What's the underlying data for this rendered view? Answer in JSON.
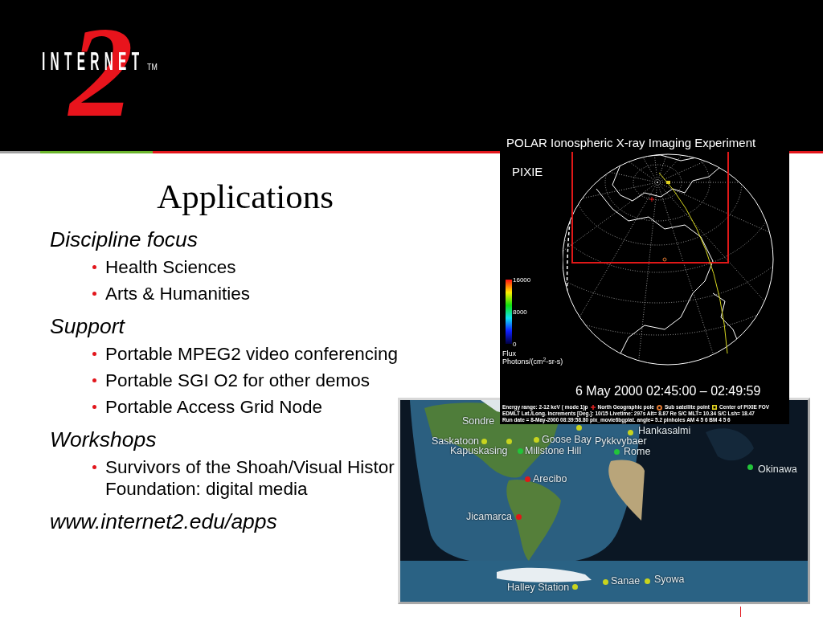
{
  "logo": {
    "numeral": "2",
    "wordmark": "INTERNET",
    "trademark": "TM"
  },
  "slide": {
    "title": "Applications",
    "sections": [
      {
        "heading": "Discipline focus",
        "bullets": [
          "Health Sciences",
          "Arts & Humanities"
        ]
      },
      {
        "heading": "Support",
        "bullets": [
          "Portable MPEG2 video conferencing",
          "Portable SGI O2 for other demos",
          "Portable Access Grid Node"
        ]
      },
      {
        "heading": "Workshops",
        "bullets": [
          "Survivors of the Shoah/Visual Histor Foundation: digital media"
        ]
      }
    ],
    "url": "www.internet2.edu/apps"
  },
  "pixie_image": {
    "title": "POLAR Ionospheric X-ray Imaging Experiment",
    "subtitle": "PIXIE",
    "scale_labels": [
      "16000",
      "8000",
      "0"
    ],
    "scale_title": "Flux",
    "scale_units": "Photons/(cm$^{2}$-sr-s)",
    "timestamp": "6 May 2000 02:45:00 – 02:49:59",
    "caption": {
      "energy_range": "Energy range: 2-12 keV ( mode 1)p",
      "legend": [
        {
          "kind": "plus",
          "label": "North Geographic pole",
          "color": "#e02020"
        },
        {
          "kind": "ring",
          "label": "Sub satellite point",
          "color": "#e07830"
        },
        {
          "kind": "square",
          "label": "Center of PIXIE FOV",
          "color": "#e0d020"
        }
      ],
      "lines": [
        "EDMLT Lat./Long. increments [Deg.]: 10/15 Livetime: 297s Alt= 8.87 Re S/C MLT= 10.34 S/C Lsh= 18.47",
        "Run date = 8-May-2000 08:39:58.80 pix_movie6bgplat. angle= 5.2 pinholes AM 4 5 6 BM 4 5 6"
      ]
    }
  },
  "map": {
    "pins": [
      {
        "label": "Sondre"
      },
      {
        "label": "Saskatoon",
        "color": "#c8d41e"
      },
      {
        "label": "Kapuskasing",
        "color": "#c8d41e"
      },
      {
        "label": "Goose Bay",
        "color": "#c8d41e"
      },
      {
        "label": "Millstone Hill",
        "color": "#22c43a"
      },
      {
        "label": "Arecibo",
        "color": "#e01818"
      },
      {
        "label": "Jicamarca",
        "color": "#e01818"
      },
      {
        "label": "Halley Station",
        "color": "#c8d41e"
      },
      {
        "label": "Pykkvybaer",
        "color": "#c8d41e"
      },
      {
        "label": "Hankasalmi",
        "color": "#c8d41e"
      },
      {
        "label": "Rome",
        "color": "#22c43a"
      },
      {
        "label": "Okinawa",
        "color": "#22c43a"
      },
      {
        "label": "Sanae",
        "color": "#c8d41e"
      },
      {
        "label": "Syowa",
        "color": "#c8d41e"
      }
    ]
  }
}
